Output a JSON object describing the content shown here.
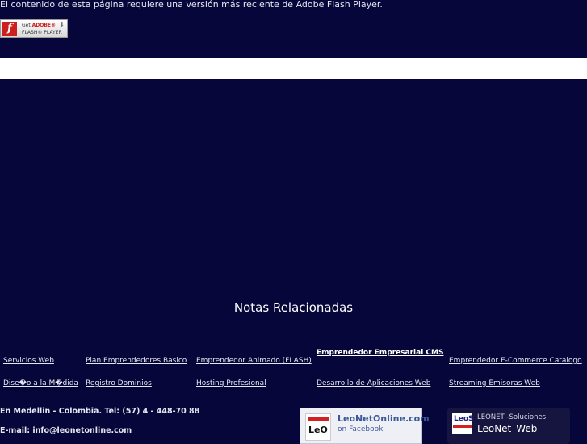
{
  "flash": {
    "message": "El contenido de esta página requiere una versión más reciente de Adobe Flash Player.",
    "badge_line1_prefix": "Get ",
    "badge_line1_brand": "ADOBE®",
    "badge_line2": "FLASH® PLAYER"
  },
  "section": {
    "title": "Notas Relacionadas"
  },
  "links": {
    "row1": [
      "Servicios Web",
      "Plan Emprendedores Basico",
      "Emprendedor Animado (FLASH)",
      "Emprendedor Empresarial CMS",
      "Emprendedor E-Commerce Catalogo"
    ],
    "row2": [
      "Dise�o a la M�dida",
      "Registro Dominios",
      "Hosting Profesional",
      "Desarrollo de Aplicaciones Web",
      "Streaming Emisoras Web"
    ]
  },
  "contact": {
    "address": "En Medellin - Colombia. Tel: (57) 4 - 448-70 88",
    "email": "E-mail: info@leonetonline.com"
  },
  "facebook": {
    "title": "LeoNetOnline.com",
    "subtitle": "on Facebook",
    "logo_text": "LeO"
  },
  "twitter": {
    "name": "LEONET -Soluciones",
    "handle": "LeoNet_Web",
    "logo_text": "LeoS"
  },
  "colors": {
    "background": "#06063a",
    "bar": "#ffffff",
    "text": "#ffffff"
  }
}
